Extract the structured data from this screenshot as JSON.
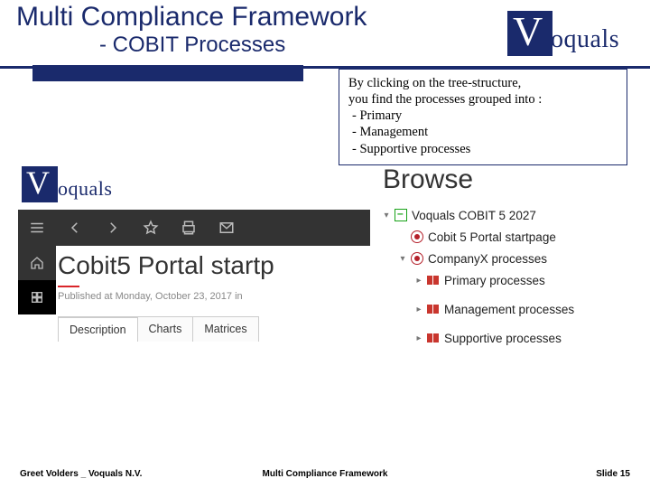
{
  "title": {
    "line1": "Multi Compliance Framework",
    "line2": "- COBIT Processes"
  },
  "brand": {
    "mark": "V",
    "name": "oquals"
  },
  "callout": {
    "l1": "By clicking on the tree-structure,",
    "l2": "you find the processes grouped into  :",
    "b1": "-   Primary",
    "b2": "-   Management",
    "b3": "-   Supportive processes"
  },
  "toolbar": {
    "menu": "menu",
    "back": "back",
    "forward": "forward",
    "star": "favorite",
    "print": "print",
    "mail": "mail"
  },
  "rail": {
    "home": "home",
    "app": "app"
  },
  "portal": {
    "title": "Cobit5 Portal startp",
    "meta": "Published at Monday, October 23, 2017 in ",
    "tabs": {
      "t1": "Description",
      "t2": "Charts",
      "t3": "Matrices"
    }
  },
  "browse": {
    "heading": "Browse",
    "n1": "Voquals COBIT 5 2027",
    "n2": "Cobit 5 Portal startpage",
    "n3": "CompanyX processes",
    "n4": "Primary processes",
    "n5": "Management processes",
    "n6": "Supportive processes"
  },
  "footer": {
    "left": "Greet Volders _ Voquals N.V.",
    "center": "Multi Compliance Framework",
    "right": "Slide 15"
  }
}
